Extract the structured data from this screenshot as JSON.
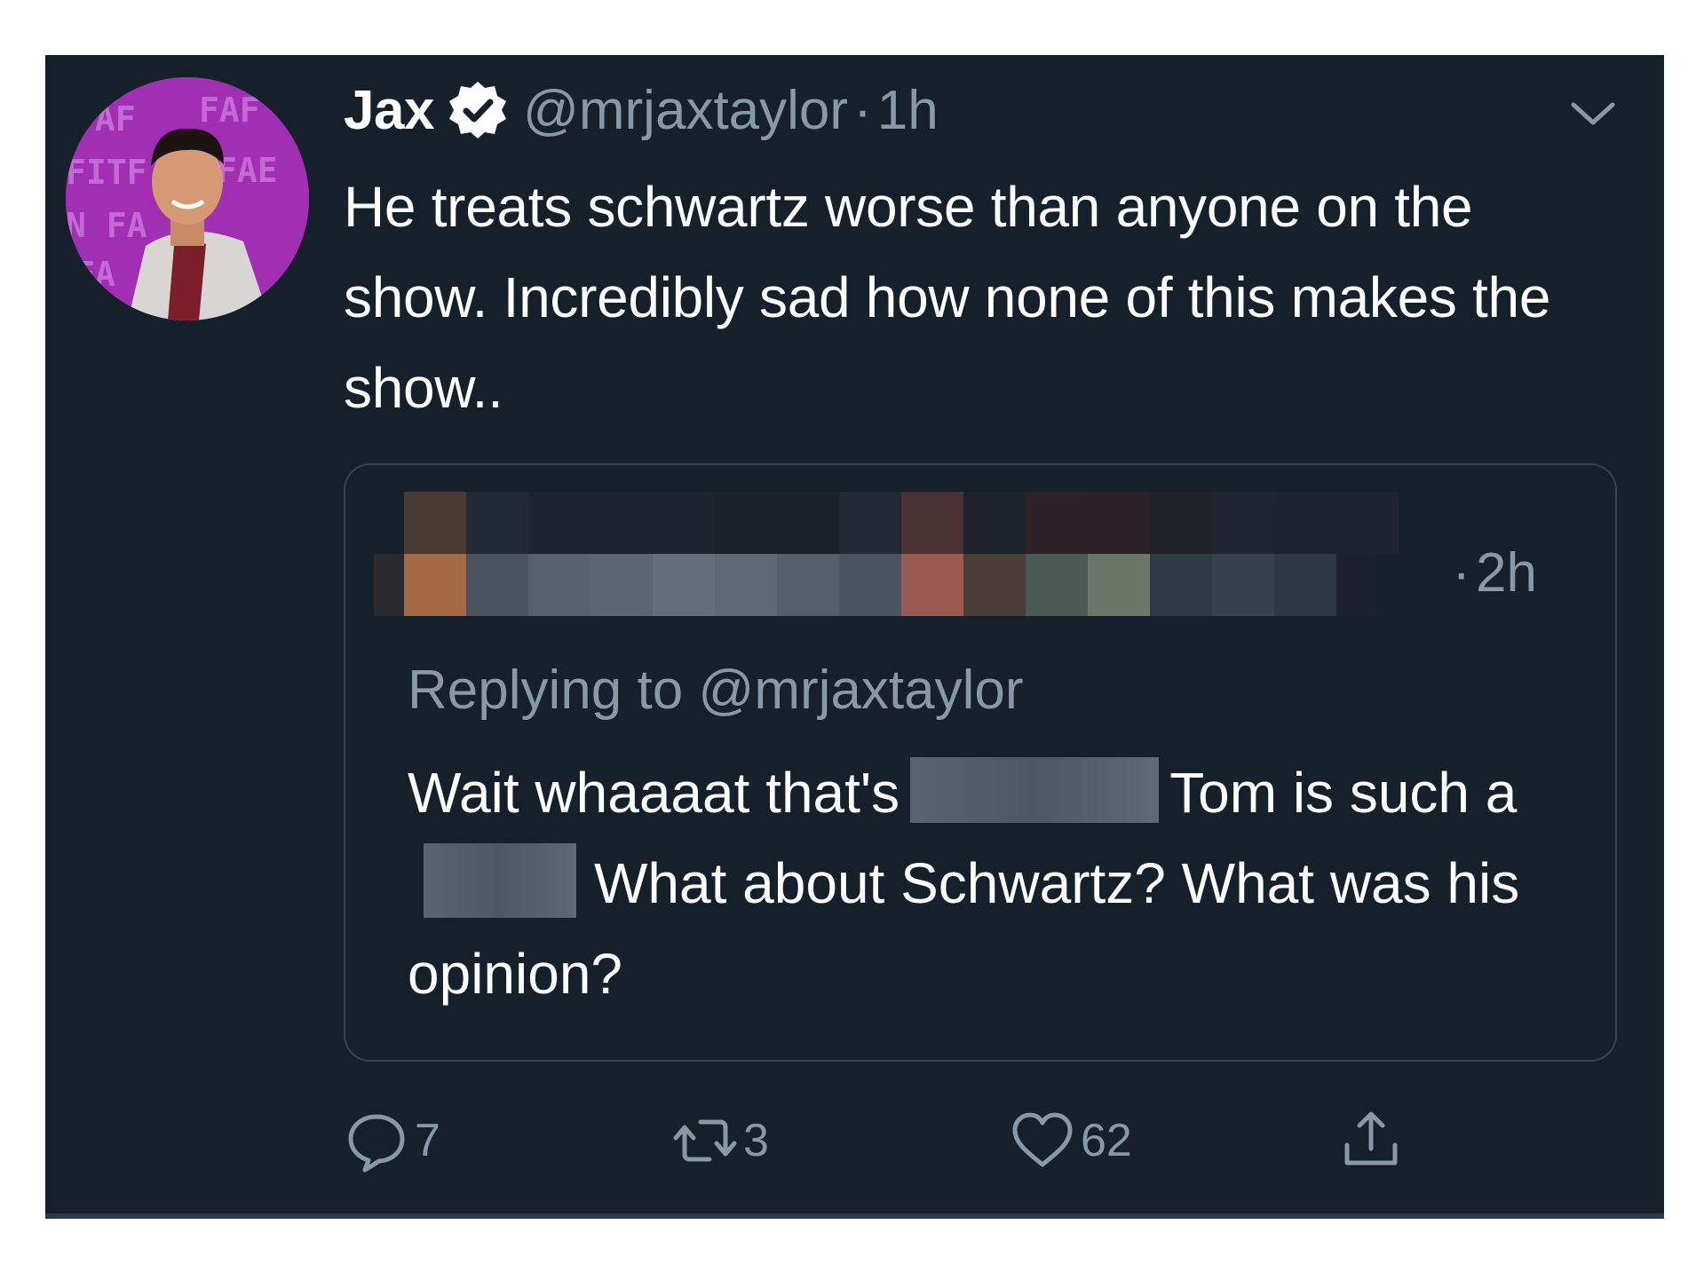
{
  "tweet": {
    "display_name": "Jax",
    "verified_icon": "verified-badge-icon",
    "handle": "@mrjaxtaylor",
    "separator": "·",
    "time": "1h",
    "text": "He treats schwartz worse than anyone on the show. Incredibly sad how none of this makes the show..",
    "menu_icon": "chevron-down-icon",
    "avatar_icon": "profile-photo"
  },
  "quoted": {
    "separator": "·",
    "time": "2h",
    "replying_to": "Replying to @mrjaxtaylor",
    "text_part1": "Wait whaaaat that's",
    "text_part2": "Tom is such a",
    "text_part3": "What about Schwartz? What was his opinion?"
  },
  "actions": {
    "reply_count": "7",
    "retweet_count": "3",
    "like_count": "62",
    "reply_icon": "reply-icon",
    "retweet_icon": "retweet-icon",
    "like_icon": "heart-icon",
    "share_icon": "share-icon"
  },
  "colors": {
    "background": "#15202b",
    "secondary_text": "#8899a6",
    "primary_text": "#ffffff",
    "border": "#38444d",
    "avatar_bg": "#a12fb4"
  }
}
